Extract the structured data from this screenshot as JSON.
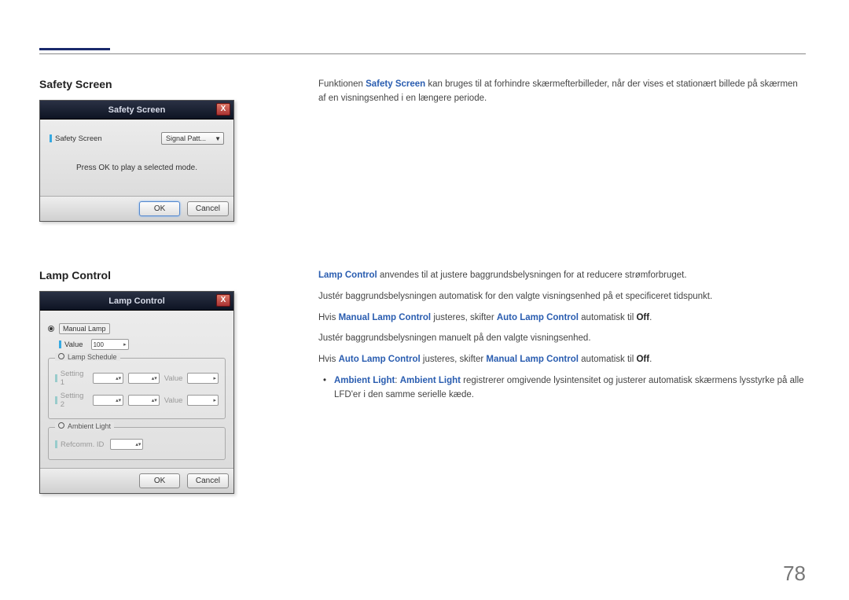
{
  "page_number": "78",
  "section1": {
    "title": "Safety Screen",
    "paragraph_a": "Funktionen ",
    "paragraph_bold": "Safety Screen",
    "paragraph_b": " kan bruges til at forhindre skærmefterbilleder, når der vises et stationært billede på skærmen af en visningsenhed i en længere periode.",
    "dialog": {
      "title": "Safety Screen",
      "field_label": "Safety Screen",
      "combo_value": "Signal Patt...",
      "hint": "Press OK to play a selected mode.",
      "ok": "OK",
      "cancel": "Cancel"
    }
  },
  "section2": {
    "title": "Lamp Control",
    "p1_bold": "Lamp Control",
    "p1_rest": " anvendes til at justere baggrundsbelysningen for at reducere strømforbruget.",
    "p2": "Justér baggrundsbelysningen automatisk for den valgte visningsenhed på et specificeret tidspunkt.",
    "p3_a": "Hvis ",
    "p3_b1": "Manual Lamp Control",
    "p3_mid": " justeres, skifter ",
    "p3_b2": "Auto Lamp Control",
    "p3_c": " automatisk til ",
    "p3_off": "Off",
    "p3_end": ".",
    "p4": "Justér baggrundsbelysningen manuelt på den valgte visningsenhed.",
    "p5_a": "Hvis ",
    "p5_b1": "Auto Lamp Control",
    "p5_mid": " justeres, skifter ",
    "p5_b2": "Manual Lamp Control",
    "p5_c": " automatisk til ",
    "p5_off": "Off",
    "p5_end": ".",
    "bullet_b1": "Ambient Light",
    "bullet_sep": ": ",
    "bullet_b2": "Ambient Light",
    "bullet_rest": " registrerer omgivende lysintensitet og justerer automatisk skærmens lysstyrke på alle LFD'er i den samme serielle kæde.",
    "dialog": {
      "title": "Lamp Control",
      "manual_lamp": "Manual Lamp",
      "value_label": "Value",
      "value_num": "100",
      "lamp_schedule": "Lamp Schedule",
      "setting1": "Setting 1",
      "setting2": "Setting 2",
      "value_col": "Value",
      "ambient_light": "Ambient Light",
      "refcomm": "Refcomm. ID",
      "ok": "OK",
      "cancel": "Cancel"
    }
  }
}
